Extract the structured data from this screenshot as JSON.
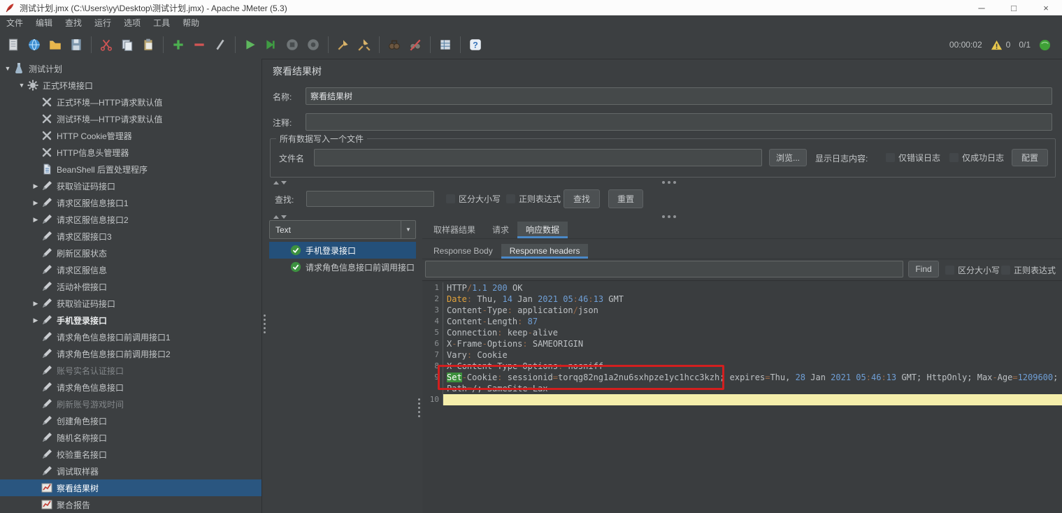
{
  "window": {
    "title": "测试计划.jmx (C:\\Users\\yy\\Desktop\\测试计划.jmx) - Apache JMeter (5.3)",
    "controls": [
      {
        "id": "minimize",
        "glyph": "─"
      },
      {
        "id": "maximize",
        "glyph": "□"
      },
      {
        "id": "close",
        "glyph": "×"
      }
    ]
  },
  "menu": {
    "items": [
      {
        "id": "file",
        "label": "文件"
      },
      {
        "id": "edit",
        "label": "编辑"
      },
      {
        "id": "search",
        "label": "查找"
      },
      {
        "id": "run",
        "label": "运行"
      },
      {
        "id": "options",
        "label": "选项"
      },
      {
        "id": "tools",
        "label": "工具"
      },
      {
        "id": "help",
        "label": "帮助"
      }
    ]
  },
  "toolbar": {
    "groups": [
      [
        "new",
        "templates",
        "open",
        "save"
      ],
      [
        "cut",
        "copy",
        "paste"
      ],
      [
        "add",
        "remove",
        "toggle"
      ],
      [
        "start",
        "start-no-pauses",
        "stop",
        "shutdown"
      ],
      [
        "clear",
        "clear-all"
      ],
      [
        "search",
        "search-reset"
      ],
      [
        "function-helper"
      ],
      [
        "help"
      ]
    ],
    "timer": "00:00:02",
    "warning_count": "0",
    "thread_count": "0/1"
  },
  "tree": {
    "items": [
      {
        "label": "测试计划",
        "level": 0,
        "arrow": "expanded",
        "icon": "test-plan"
      },
      {
        "label": "正式环境接口",
        "level": 1,
        "arrow": "expanded",
        "icon": "gear"
      },
      {
        "label": "正式环境—HTTP请求默认值",
        "level": 2,
        "arrow": "none",
        "icon": "wrench"
      },
      {
        "label": "测试环境—HTTP请求默认值",
        "level": 2,
        "arrow": "none",
        "icon": "wrench"
      },
      {
        "label": "HTTP Cookie管理器",
        "level": 2,
        "arrow": "none",
        "icon": "wrench"
      },
      {
        "label": "HTTP信息头管理器",
        "level": 2,
        "arrow": "none",
        "icon": "wrench"
      },
      {
        "label": "BeanShell 后置处理程序",
        "level": 2,
        "arrow": "none",
        "icon": "doc"
      },
      {
        "label": "获取验证码接口",
        "level": 2,
        "arrow": "collapsed",
        "icon": "pencil"
      },
      {
        "label": "请求区服信息接口1",
        "level": 2,
        "arrow": "collapsed",
        "icon": "pencil"
      },
      {
        "label": "请求区服信息接口2",
        "level": 2,
        "arrow": "collapsed",
        "icon": "pencil"
      },
      {
        "label": "请求区服接口3",
        "level": 2,
        "arrow": "none",
        "icon": "pencil"
      },
      {
        "label": "刷新区服状态",
        "level": 2,
        "arrow": "none",
        "icon": "pencil"
      },
      {
        "label": "请求区服信息",
        "level": 2,
        "arrow": "none",
        "icon": "pencil"
      },
      {
        "label": "活动补偿接口",
        "level": 2,
        "arrow": "none",
        "icon": "pencil"
      },
      {
        "label": "获取验证码接口",
        "level": 2,
        "arrow": "collapsed",
        "icon": "pencil"
      },
      {
        "label": "手机登录接口",
        "level": 2,
        "arrow": "collapsed",
        "icon": "pencil",
        "bold": true
      },
      {
        "label": "请求角色信息接口前调用接口1",
        "level": 2,
        "arrow": "none",
        "icon": "pencil"
      },
      {
        "label": "请求角色信息接口前调用接口2",
        "level": 2,
        "arrow": "none",
        "icon": "pencil"
      },
      {
        "label": "账号实名认证接口",
        "level": 2,
        "arrow": "none",
        "icon": "pencil",
        "dim": true
      },
      {
        "label": "请求角色信息接口",
        "level": 2,
        "arrow": "none",
        "icon": "pencil"
      },
      {
        "label": "刷新账号游戏时间",
        "level": 2,
        "arrow": "none",
        "icon": "pencil",
        "dim": true
      },
      {
        "label": "创建角色接口",
        "level": 2,
        "arrow": "none",
        "icon": "pencil"
      },
      {
        "label": "随机名称接口",
        "level": 2,
        "arrow": "none",
        "icon": "pencil"
      },
      {
        "label": "校验重名接口",
        "level": 2,
        "arrow": "none",
        "icon": "pencil"
      },
      {
        "label": "调试取样器",
        "level": 2,
        "arrow": "none",
        "icon": "pencil"
      },
      {
        "label": "察看结果树",
        "level": 2,
        "arrow": "none",
        "icon": "chart",
        "selected": true
      },
      {
        "label": "聚合报告",
        "level": 2,
        "arrow": "none",
        "icon": "chart"
      }
    ]
  },
  "main": {
    "title": "察看结果树",
    "name_label": "名称:",
    "name_value": "察看结果树",
    "comment_label": "注释:",
    "comment_value": "",
    "file_group": {
      "title": "所有数据写入一个文件",
      "filename_label": "文件名",
      "filename_value": "",
      "browse_button": "浏览...",
      "log_display_label": "显示日志内容:",
      "errors_only": "仅错误日志",
      "success_only": "仅成功日志",
      "config_button": "配置"
    },
    "search_row": {
      "label": "查找:",
      "value": "",
      "case_label": "区分大小写",
      "regex_label": "正则表达式",
      "find_button": "查找",
      "reset_button": "重置"
    }
  },
  "results": {
    "view_mode": "Text",
    "samples": [
      {
        "label": "手机登录接口",
        "selected": true
      },
      {
        "label": "请求角色信息接口前调用接口",
        "selected": false
      }
    ],
    "tabs": [
      {
        "id": "sampler-result",
        "label": "取样器结果",
        "active": false
      },
      {
        "id": "request",
        "label": "请求",
        "active": false
      },
      {
        "id": "response-data",
        "label": "响应数据",
        "active": true
      }
    ],
    "subtabs": [
      {
        "id": "response-body",
        "label": "Response Body",
        "active": false
      },
      {
        "id": "response-headers",
        "label": "Response headers",
        "active": true
      }
    ],
    "find_bar": {
      "value": "",
      "find_button": "Find",
      "case_label": "区分大小写",
      "regex_label": "正则表达式"
    }
  },
  "editor": {
    "rows": [
      {
        "num": "1",
        "tokens": [
          [
            "HTTP",
            "d"
          ],
          [
            "/",
            "p"
          ],
          [
            "1.1",
            "n"
          ],
          [
            " ",
            "d"
          ],
          [
            "200",
            "n"
          ],
          [
            " OK",
            "d"
          ]
        ]
      },
      {
        "num": "2",
        "tokens": [
          [
            "Date",
            "k"
          ],
          [
            ":",
            "p"
          ],
          [
            " Thu, ",
            "d"
          ],
          [
            "14",
            "n"
          ],
          [
            " Jan ",
            "d"
          ],
          [
            "2021",
            "n"
          ],
          [
            " ",
            "d"
          ],
          [
            "05",
            "n"
          ],
          [
            ":",
            "p"
          ],
          [
            "46",
            "n"
          ],
          [
            ":",
            "p"
          ],
          [
            "13",
            "n"
          ],
          [
            " GMT",
            "d"
          ]
        ]
      },
      {
        "num": "3",
        "tokens": [
          [
            "Content",
            "d"
          ],
          [
            "-",
            "p"
          ],
          [
            "Type",
            "d"
          ],
          [
            ":",
            "p"
          ],
          [
            " application",
            "d"
          ],
          [
            "/",
            "p"
          ],
          [
            "json",
            "d"
          ]
        ]
      },
      {
        "num": "4",
        "tokens": [
          [
            "Content",
            "d"
          ],
          [
            "-",
            "p"
          ],
          [
            "Length",
            "d"
          ],
          [
            ":",
            "p"
          ],
          [
            " ",
            "d"
          ],
          [
            "87",
            "n"
          ]
        ]
      },
      {
        "num": "5",
        "tokens": [
          [
            "Connection",
            "d"
          ],
          [
            ":",
            "p"
          ],
          [
            " keep",
            "d"
          ],
          [
            "-",
            "p"
          ],
          [
            "alive",
            "d"
          ]
        ]
      },
      {
        "num": "6",
        "tokens": [
          [
            "X",
            "d"
          ],
          [
            "-",
            "p"
          ],
          [
            "Frame",
            "d"
          ],
          [
            "-",
            "p"
          ],
          [
            "Options",
            "d"
          ],
          [
            ":",
            "p"
          ],
          [
            " SAMEORIGIN",
            "d"
          ]
        ]
      },
      {
        "num": "7",
        "tokens": [
          [
            "Vary",
            "d"
          ],
          [
            ":",
            "p"
          ],
          [
            " Cookie",
            "d"
          ]
        ]
      },
      {
        "num": "8",
        "tokens": [
          [
            "X",
            "d"
          ],
          [
            "-",
            "p"
          ],
          [
            "Content",
            "d"
          ],
          [
            "-",
            "p"
          ],
          [
            "Type",
            "d"
          ],
          [
            "-",
            "p"
          ],
          [
            "Options",
            "d"
          ],
          [
            ":",
            "p"
          ],
          [
            " nosniff",
            "d"
          ]
        ]
      },
      {
        "num": "9",
        "tokens": [
          [
            "Set",
            "m"
          ],
          [
            "-",
            "p"
          ],
          [
            "Cookie",
            "d"
          ],
          [
            ":",
            "p"
          ],
          [
            " sessionid",
            "d"
          ],
          [
            "=",
            "p"
          ],
          [
            "torqg82ng1a2nu6sxhpze1yc1hcc3kzh",
            "d"
          ],
          [
            "; expires",
            "d"
          ],
          [
            "=",
            "p"
          ],
          [
            "Thu, ",
            "d"
          ],
          [
            "28",
            "n"
          ],
          [
            " Jan ",
            "d"
          ],
          [
            "2021",
            "n"
          ],
          [
            " ",
            "d"
          ],
          [
            "05",
            "n"
          ],
          [
            ":",
            "p"
          ],
          [
            "46",
            "n"
          ],
          [
            ":",
            "p"
          ],
          [
            "13",
            "n"
          ],
          [
            " GMT; HttpOnly; Max",
            "d"
          ],
          [
            "-",
            "p"
          ],
          [
            "Age",
            "d"
          ],
          [
            "=",
            "p"
          ],
          [
            "1209600",
            "n"
          ],
          [
            ";",
            "d"
          ]
        ]
      },
      {
        "num": "",
        "tokens": [
          [
            "Path",
            "d"
          ],
          [
            "=",
            "p"
          ],
          [
            "/",
            "d"
          ],
          [
            "; SameSite",
            "d"
          ],
          [
            "=",
            "p"
          ],
          [
            "Lax",
            "d"
          ]
        ]
      },
      {
        "num": "10",
        "tokens": [],
        "current": true
      }
    ]
  }
}
